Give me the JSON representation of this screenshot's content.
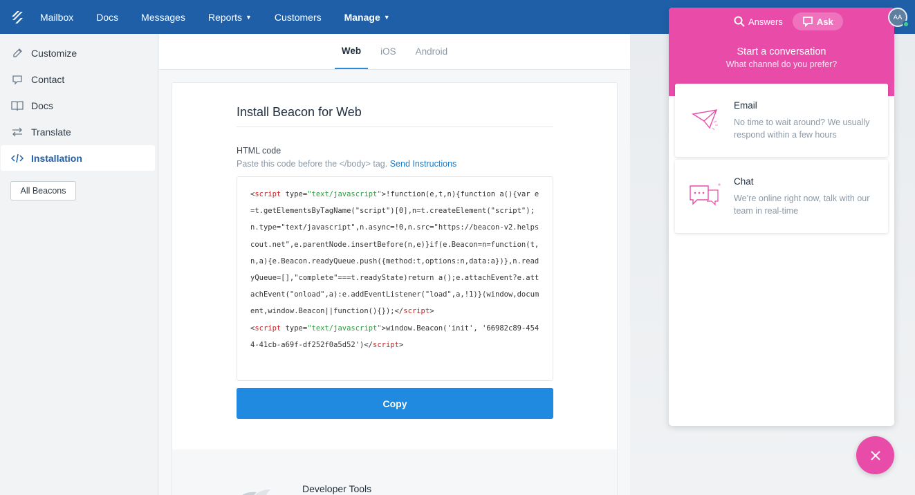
{
  "topnav": {
    "items": [
      {
        "label": "Mailbox"
      },
      {
        "label": "Docs"
      },
      {
        "label": "Messages"
      },
      {
        "label": "Reports"
      },
      {
        "label": "Customers"
      },
      {
        "label": "Manage"
      }
    ],
    "avatar_initials": "AA"
  },
  "sidebar": {
    "items": [
      {
        "label": "Customize",
        "icon": "pencil-icon"
      },
      {
        "label": "Contact",
        "icon": "chat-bubble-icon"
      },
      {
        "label": "Docs",
        "icon": "book-icon"
      },
      {
        "label": "Translate",
        "icon": "arrows-icon"
      },
      {
        "label": "Installation",
        "icon": "code-icon"
      }
    ],
    "all_beacons_label": "All Beacons"
  },
  "main": {
    "tabs": [
      {
        "label": "Web"
      },
      {
        "label": "iOS"
      },
      {
        "label": "Android"
      }
    ],
    "card_title": "Install Beacon for Web",
    "code_label": "HTML code",
    "code_hint": "Paste this code before the </body> tag.",
    "send_instructions": "Send Instructions",
    "code": {
      "script1_open_a": "<",
      "script1_open_tag": "script",
      "script1_type_attr": " type=",
      "script1_type_val": "\"text/javascript\"",
      "script1_body": ">!function(e,t,n){function a(){var e=t.getElementsByTagName(\"script\")[0],n=t.createElement(\"script\");n.type=\"text/javascript\",n.async=!0,n.src=\"https://beacon-v2.helpscout.net\",e.parentNode.insertBefore(n,e)}if(e.Beacon=n=function(t,n,a){e.Beacon.readyQueue.push({method:t,options:n,data:a})},n.readyQueue=[],\"complete\"===t.readyState)return a();e.attachEvent?e.attachEvent(\"onload\",a):e.addEventListener(\"load\",a,!1)}(window,document,window.Beacon||function(){});</",
      "script1_close_tag": "script",
      "script2_type_val": "\"text/javascript\"",
      "script2_body": ">window.Beacon('init', '66982c89-4544-41cb-a69f-df252f0a5d52')</",
      "script2_close_tag": "script"
    },
    "copy_label": "Copy",
    "dev_tools_title": "Developer Tools"
  },
  "beacon": {
    "tabs": [
      {
        "label": "Answers"
      },
      {
        "label": "Ask"
      }
    ],
    "title": "Start a conversation",
    "subtitle": "What channel do you prefer?",
    "options": [
      {
        "title": "Email",
        "desc": "No time to wait around? We usually respond within a few hours"
      },
      {
        "title": "Chat",
        "desc": "We’re online right now, talk with our team in real-time"
      }
    ]
  },
  "colors": {
    "nav": "#1f5fa8",
    "accent": "#1f8ae0",
    "beacon_pink": "#e94ba9"
  }
}
